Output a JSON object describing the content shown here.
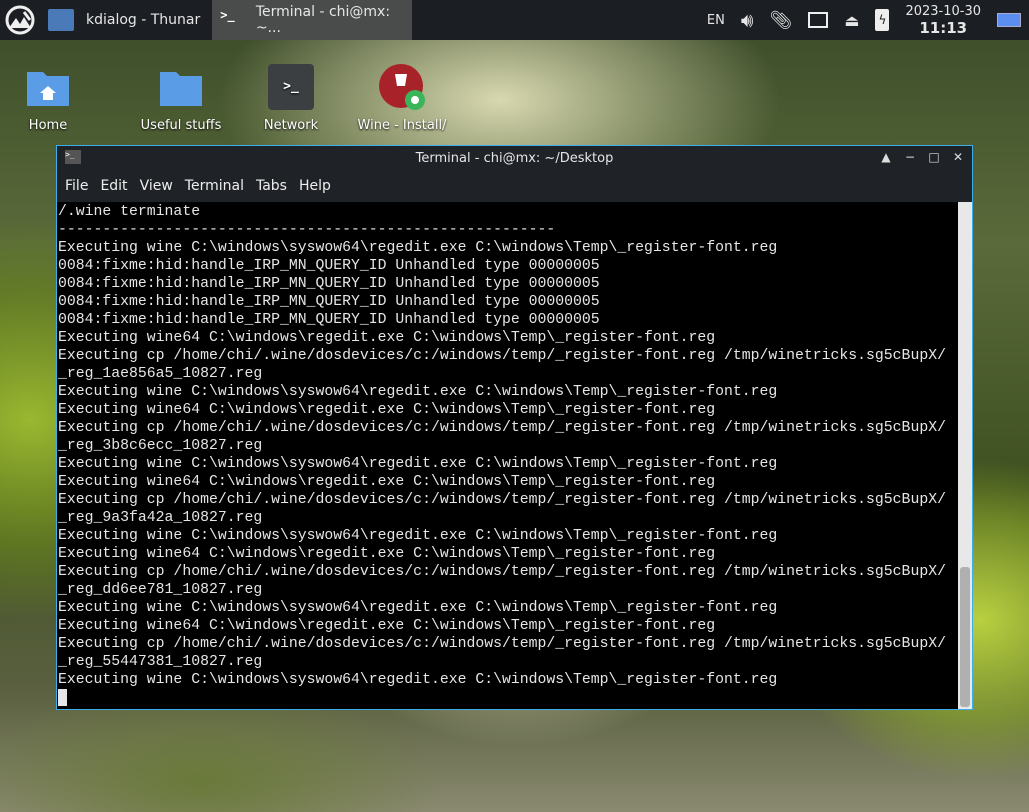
{
  "panel": {
    "tasks": [
      {
        "label": "kdialog - Thunar",
        "active": false
      },
      {
        "label": "Terminal - chi@mx: ~...",
        "active": true
      }
    ],
    "tray": {
      "lang": "EN",
      "date": "2023-10-30",
      "time": "11:13"
    }
  },
  "desktop": {
    "icons": [
      {
        "label": "Home"
      },
      {
        "label": "Useful stuffs"
      },
      {
        "label": "Network"
      },
      {
        "label": "Wine - Install/"
      }
    ]
  },
  "window": {
    "title": "Terminal - chi@mx: ~/Desktop",
    "menu": [
      "File",
      "Edit",
      "View",
      "Terminal",
      "Tabs",
      "Help"
    ],
    "lines": [
      "/.wine terminate",
      "--------------------------------------------------------",
      "Executing wine C:\\windows\\syswow64\\regedit.exe C:\\windows\\Temp\\_register-font.reg",
      "0084:fixme:hid:handle_IRP_MN_QUERY_ID Unhandled type 00000005",
      "0084:fixme:hid:handle_IRP_MN_QUERY_ID Unhandled type 00000005",
      "0084:fixme:hid:handle_IRP_MN_QUERY_ID Unhandled type 00000005",
      "0084:fixme:hid:handle_IRP_MN_QUERY_ID Unhandled type 00000005",
      "Executing wine64 C:\\windows\\regedit.exe C:\\windows\\Temp\\_register-font.reg",
      "Executing cp /home/chi/.wine/dosdevices/c:/windows/temp/_register-font.reg /tmp/winetricks.sg5cBupX/",
      "_reg_1ae856a5_10827.reg",
      "Executing wine C:\\windows\\syswow64\\regedit.exe C:\\windows\\Temp\\_register-font.reg",
      "Executing wine64 C:\\windows\\regedit.exe C:\\windows\\Temp\\_register-font.reg",
      "Executing cp /home/chi/.wine/dosdevices/c:/windows/temp/_register-font.reg /tmp/winetricks.sg5cBupX/",
      "_reg_3b8c6ecc_10827.reg",
      "Executing wine C:\\windows\\syswow64\\regedit.exe C:\\windows\\Temp\\_register-font.reg",
      "Executing wine64 C:\\windows\\regedit.exe C:\\windows\\Temp\\_register-font.reg",
      "Executing cp /home/chi/.wine/dosdevices/c:/windows/temp/_register-font.reg /tmp/winetricks.sg5cBupX/",
      "_reg_9a3fa42a_10827.reg",
      "Executing wine C:\\windows\\syswow64\\regedit.exe C:\\windows\\Temp\\_register-font.reg",
      "Executing wine64 C:\\windows\\regedit.exe C:\\windows\\Temp\\_register-font.reg",
      "Executing cp /home/chi/.wine/dosdevices/c:/windows/temp/_register-font.reg /tmp/winetricks.sg5cBupX/",
      "_reg_dd6ee781_10827.reg",
      "Executing wine C:\\windows\\syswow64\\regedit.exe C:\\windows\\Temp\\_register-font.reg",
      "Executing wine64 C:\\windows\\regedit.exe C:\\windows\\Temp\\_register-font.reg",
      "Executing cp /home/chi/.wine/dosdevices/c:/windows/temp/_register-font.reg /tmp/winetricks.sg5cBupX/",
      "_reg_55447381_10827.reg",
      "Executing wine C:\\windows\\syswow64\\regedit.exe C:\\windows\\Temp\\_register-font.reg"
    ]
  }
}
